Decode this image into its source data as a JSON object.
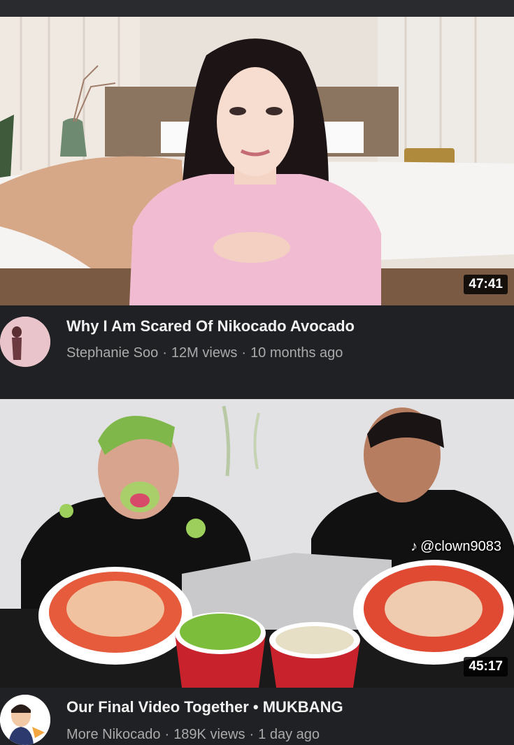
{
  "videos": [
    {
      "title": "Why I Am Scared Of Nikocado Avocado",
      "channel": "Stephanie Soo",
      "views": "12M views",
      "age": "10 months ago",
      "duration": "47:41"
    },
    {
      "title": "Our Final Video Together • MUKBANG",
      "channel": "More Nikocado",
      "views": "189K views",
      "age": "1 day ago",
      "duration": "45:17"
    }
  ],
  "watermark": {
    "icon": "tiktok-icon",
    "handle": "@clown9083"
  },
  "separator": "·"
}
